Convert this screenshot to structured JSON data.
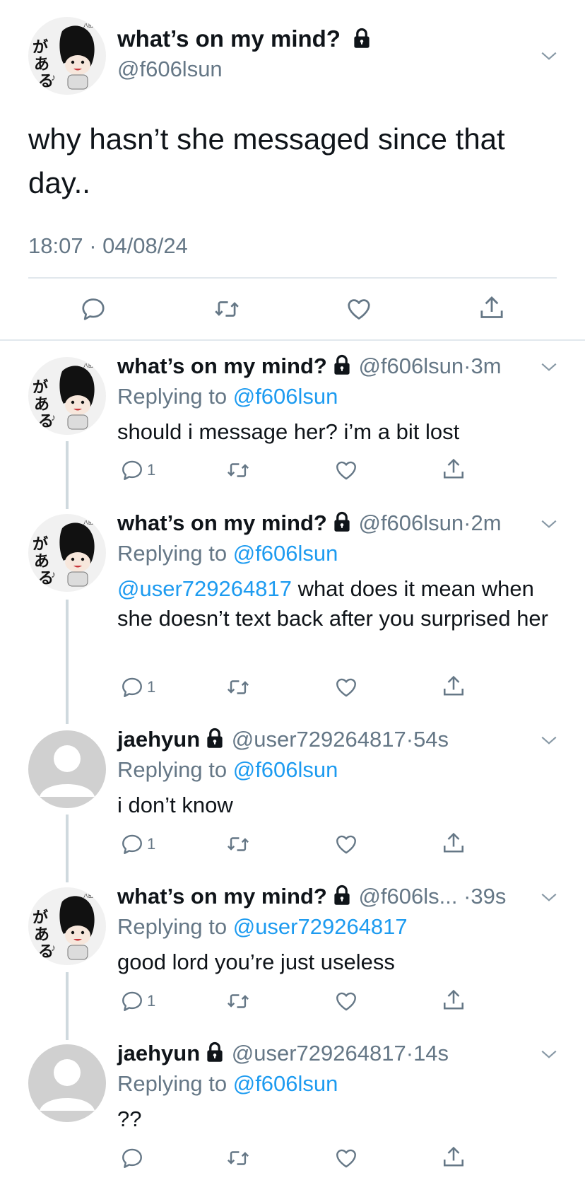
{
  "main_tweet": {
    "display_name": "what’s on my mind?",
    "handle": "@f606lsun",
    "text": "why hasn’t she messaged since that day..",
    "timestamp": "18:07 · 04/08/24"
  },
  "replies": [
    {
      "display_name": "what’s on my mind?",
      "handle": "@f606lsun",
      "time": "3m",
      "replying_label": "Replying to",
      "replying_to": "@f606lsun",
      "mention": "",
      "text": "should i message her? i’m a bit lost",
      "reply_count": "1"
    },
    {
      "display_name": "what’s on my mind?",
      "handle": "@f606lsun",
      "time": "2m",
      "replying_label": "Replying to",
      "replying_to": "@f606lsun",
      "mention": "@user729264817",
      "text": " what does it mean when she doesn’t text back after you surprised her",
      "reply_count": "1"
    },
    {
      "display_name": "jaehyun",
      "handle": "@user729264817",
      "time": "54s",
      "replying_label": "Replying to",
      "replying_to": "@f606lsun",
      "mention": "",
      "text": "i don’t know",
      "reply_count": "1"
    },
    {
      "display_name": "what’s on my mind?",
      "handle": "@f606ls...",
      "time": "39s",
      "replying_label": "Replying to",
      "replying_to": "@user729264817",
      "mention": "",
      "text": "good lord you’re just useless",
      "reply_count": "1"
    },
    {
      "display_name": "jaehyun",
      "handle": "@user729264817",
      "time": "14s",
      "replying_label": "Replying to",
      "replying_to": "@f606lsun",
      "mention": "",
      "text": "??",
      "reply_count": ""
    }
  ],
  "colors": {
    "link": "#1d9bf0",
    "secondary_text": "#657786",
    "divider": "#cfd9de"
  },
  "icons": [
    "lock-icon",
    "chevron-down-icon",
    "reply-icon",
    "retweet-icon",
    "like-icon",
    "share-icon"
  ]
}
